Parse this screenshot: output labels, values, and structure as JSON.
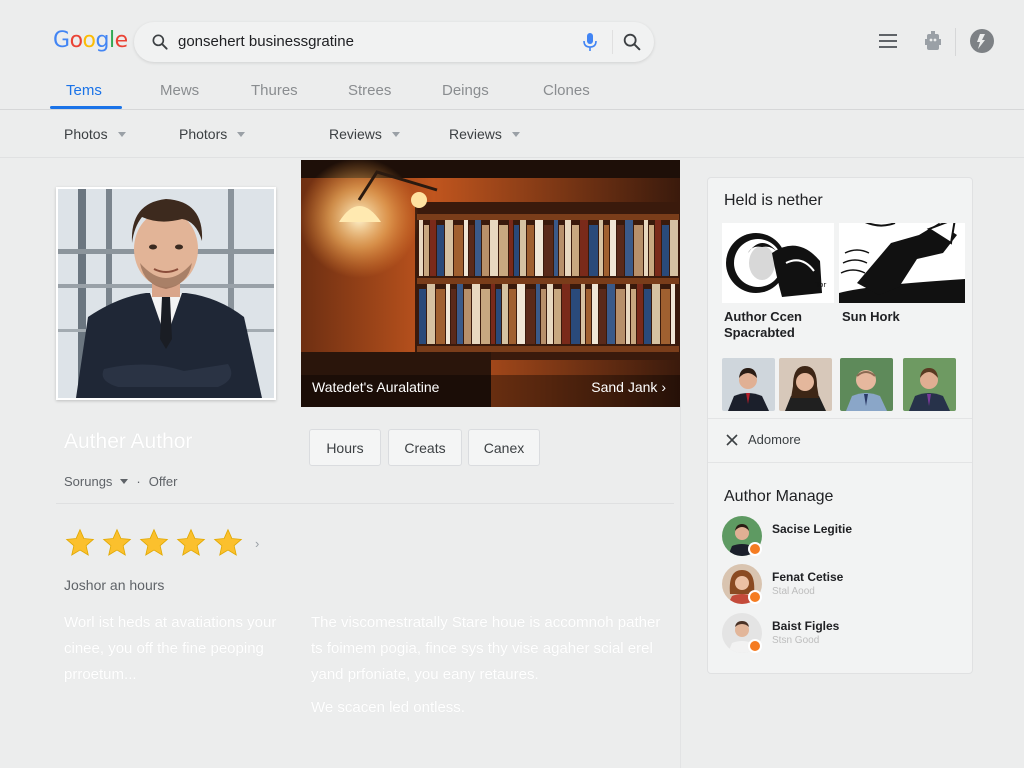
{
  "header": {
    "logo": "Google",
    "logo_colors": [
      "#4285F4",
      "#EA4335",
      "#FBBC05",
      "#4285F4",
      "#34A853",
      "#EA4335"
    ],
    "search_value": "gonsehert businessgratine",
    "icons": [
      "search-icon",
      "mic-icon",
      "menu-icon",
      "apps-icon",
      "account-icon"
    ]
  },
  "tabs": [
    {
      "label": "Tems",
      "active": true
    },
    {
      "label": "Mews"
    },
    {
      "label": "Thures"
    },
    {
      "label": "Strees"
    },
    {
      "label": "Deings"
    },
    {
      "label": "Clones"
    }
  ],
  "filters": [
    {
      "label": "Photos"
    },
    {
      "label": "Photors"
    },
    {
      "label": "Reviews"
    },
    {
      "label": "Reviews"
    }
  ],
  "hero": {
    "caption": "Watedet's Auralatine",
    "link": "Sand Jank"
  },
  "profile": {
    "name": "Auther Author",
    "meta_primary": "Sorungs",
    "meta_secondary": "Offer",
    "actions": [
      "Hours",
      "Creats",
      "Canex"
    ],
    "rating": 5,
    "hours_label": "Joshor an hours",
    "desc_left": "Worl ist heds at avatiations your cinee, you off the fine peoping prroetum...",
    "desc_right": "The viscomestratally Stare houe is accomnoh pather ts foimem pogia, fince sys thy vise agaher scial erel yand prfoniate, you eany retaures.",
    "desc_more": "We scacen led ontless."
  },
  "panel": {
    "title": "Held is nether",
    "captions": [
      "Author Ccen Spacrabted",
      "Sun Hork"
    ],
    "admore": "Adomore",
    "section": "Author Manage",
    "people": [
      {
        "name": "Sacise Legitie",
        "sub": ""
      },
      {
        "name": "Fenat Cetise",
        "sub": "Stal Aood"
      },
      {
        "name": "Baist Figles",
        "sub": "Stsn Good"
      }
    ]
  },
  "colors": {
    "accent": "#1a73e8",
    "star": "#fbc02d",
    "badge": "#f57c22"
  }
}
